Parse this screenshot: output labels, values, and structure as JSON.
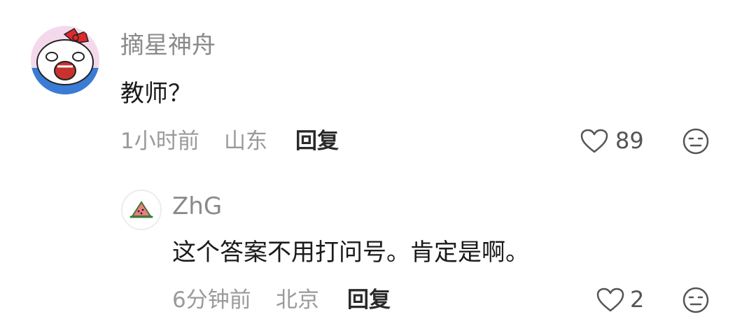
{
  "comment": {
    "username": "摘星神舟",
    "text": "教师？",
    "time": "1小时前",
    "location": "山东",
    "reply_label": "回复",
    "like_count": "89"
  },
  "reply": {
    "username": "ZhG",
    "text": "这个答案不用打问号。肯定是啊。",
    "time": "6分钟前",
    "location": "北京",
    "reply_label": "回复",
    "like_count": "2"
  },
  "icons": {
    "like": "heart-outline-icon",
    "dislike": "meh-face-icon",
    "avatar1": "cartoon-cat-avatar",
    "avatar2": "watermelon-slice-avatar"
  },
  "colors": {
    "username": "#8a8a8a",
    "meta": "#9a9a9a",
    "text": "#1a1a1a",
    "reply": "#2a2a2a"
  }
}
